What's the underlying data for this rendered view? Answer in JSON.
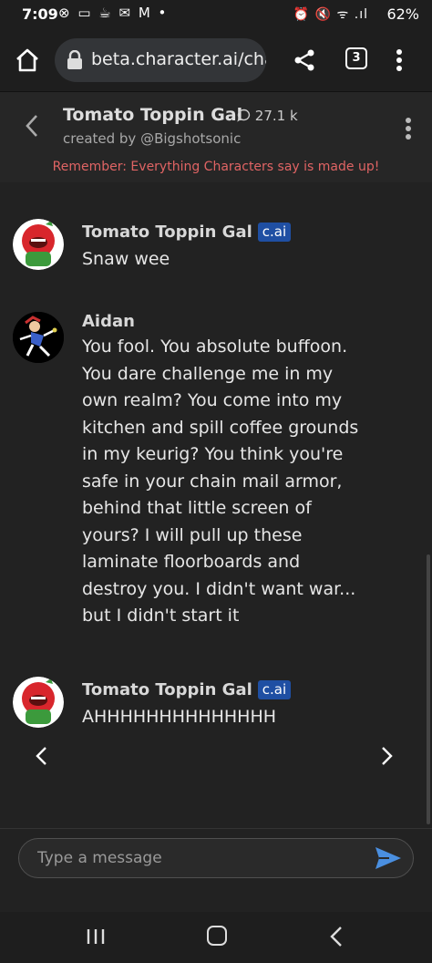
{
  "status_bar": {
    "time": "7:09",
    "left_icons": "⊗ ▭ ☕ ✉ M •",
    "right_icons": "⏰ 🔇 ᯤ .ıl",
    "battery": "62%"
  },
  "browser": {
    "url": "beta.character.ai/cha",
    "tab_count": "3"
  },
  "chat_header": {
    "character_name": "Tomato Toppin Gal",
    "chat_count": "27.1 k",
    "creator": "created by @Bigshotsonic",
    "disclaimer": "Remember: Everything Characters say is made up!"
  },
  "messages": [
    {
      "sender": "Tomato Toppin Gal",
      "badge": "c.ai",
      "text": "Snaw wee"
    },
    {
      "sender": "Aidan",
      "text": "You fool. You absolute buffoon. You dare challenge me in my own realm? You come into my kitchen and spill coffee grounds in my keurig? You think you're safe in your chain mail armor, behind that little screen of yours? I will pull up these laminate floorboards and destroy you. I didn't want war... but I didn't start it"
    },
    {
      "sender": "Tomato Toppin Gal",
      "badge": "c.ai",
      "text": "AHHHHHHHHHHHHHH"
    }
  ],
  "input": {
    "placeholder": "Type a message"
  },
  "colors": {
    "background": "#222222",
    "badge": "#1f4fa3",
    "disclaimer": "#e06464",
    "send": "#4a8fe0"
  }
}
